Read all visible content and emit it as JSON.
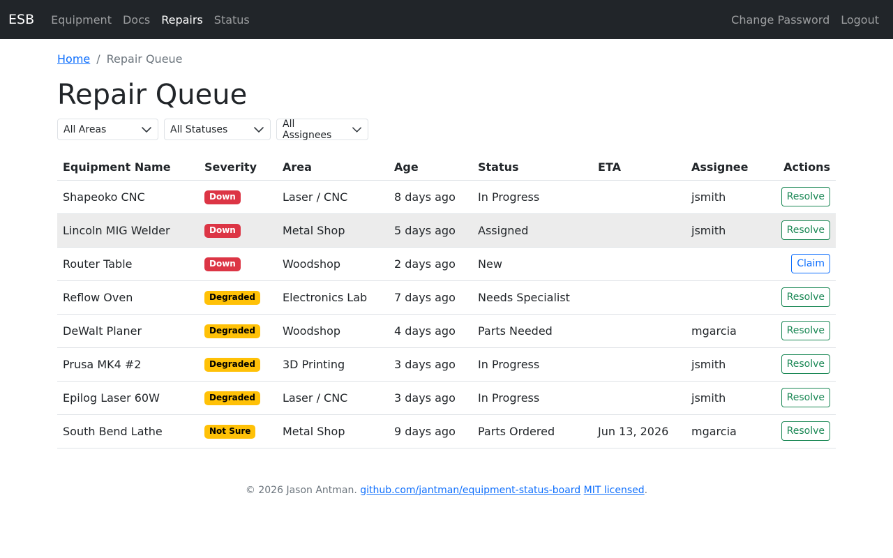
{
  "navbar": {
    "brand": "ESB",
    "links": [
      "Equipment",
      "Docs",
      "Repairs",
      "Status"
    ],
    "active": "Repairs",
    "right_links": [
      "Change Password",
      "Logout"
    ]
  },
  "breadcrumb": {
    "home": "Home",
    "separator": "/",
    "current": "Repair Queue"
  },
  "page_title": "Repair Queue",
  "filters": {
    "area": "All Areas",
    "status": "All Statuses",
    "assignee": "All Assignees"
  },
  "table": {
    "headers": [
      "Equipment Name",
      "Severity",
      "Area",
      "Age",
      "Status",
      "ETA",
      "Assignee",
      "Actions"
    ],
    "rows": [
      {
        "name": "Shapeoko CNC",
        "severity": "Down",
        "area": "Laser / CNC",
        "age": "8 days ago",
        "status": "In Progress",
        "eta": "",
        "assignee": "jsmith",
        "action": "Resolve"
      },
      {
        "name": "Lincoln MIG Welder",
        "severity": "Down",
        "area": "Metal Shop",
        "age": "5 days ago",
        "status": "Assigned",
        "eta": "",
        "assignee": "jsmith",
        "action": "Resolve"
      },
      {
        "name": "Router Table",
        "severity": "Down",
        "area": "Woodshop",
        "age": "2 days ago",
        "status": "New",
        "eta": "",
        "assignee": "",
        "action": "Claim"
      },
      {
        "name": "Reflow Oven",
        "severity": "Degraded",
        "area": "Electronics Lab",
        "age": "7 days ago",
        "status": "Needs Specialist",
        "eta": "",
        "assignee": "",
        "action": "Resolve"
      },
      {
        "name": "DeWalt Planer",
        "severity": "Degraded",
        "area": "Woodshop",
        "age": "4 days ago",
        "status": "Parts Needed",
        "eta": "",
        "assignee": "mgarcia",
        "action": "Resolve"
      },
      {
        "name": "Prusa MK4 #2",
        "severity": "Degraded",
        "area": "3D Printing",
        "age": "3 days ago",
        "status": "In Progress",
        "eta": "",
        "assignee": "jsmith",
        "action": "Resolve"
      },
      {
        "name": "Epilog Laser 60W",
        "severity": "Degraded",
        "area": "Laser / CNC",
        "age": "3 days ago",
        "status": "In Progress",
        "eta": "",
        "assignee": "jsmith",
        "action": "Resolve"
      },
      {
        "name": "South Bend Lathe",
        "severity": "Not Sure",
        "area": "Metal Shop",
        "age": "9 days ago",
        "status": "Parts Ordered",
        "eta": "Jun 13, 2026",
        "assignee": "mgarcia",
        "action": "Resolve"
      }
    ]
  },
  "footer": {
    "copyright": "© 2026 Jason Antman.",
    "repo_link": "github.com/jantman/equipment-status-board",
    "license_link": "MIT licensed",
    "end": "."
  },
  "colors": {
    "navbar_bg": "#212529",
    "down": "#dc3545",
    "degraded": "#ffc107",
    "success": "#198754",
    "primary": "#0d6efd"
  }
}
